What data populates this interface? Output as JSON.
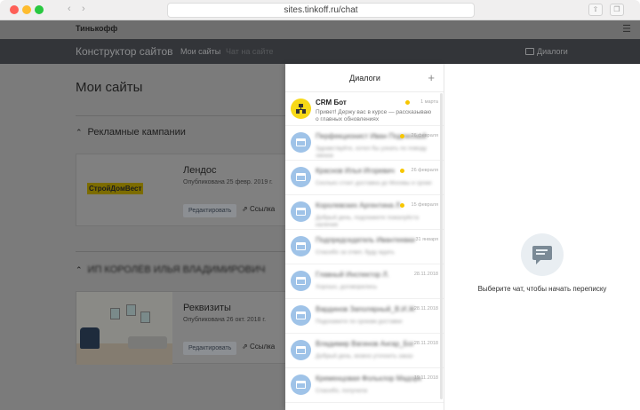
{
  "browser": {
    "url": "sites.tinkoff.ru/chat",
    "back_icon": "chevron-left-icon",
    "forward_icon": "chevron-right-icon"
  },
  "site": {
    "brand": "Тинькофф",
    "app_title": "Конструктор сайтов",
    "nav": [
      "Мои сайты",
      "Чат на сайте"
    ],
    "dialogs_link": "Диалоги"
  },
  "page": {
    "title": "Мои сайты",
    "sections": [
      {
        "title": "Рекламные кампании",
        "chevron": "^",
        "site": {
          "name": "Лендос",
          "date": "Опубликована 25 февр. 2019 г.",
          "logo_text": "СтройДомВест",
          "edit_label": "Редактировать",
          "link_label": "Ссылка"
        }
      },
      {
        "title": "ИП КОРОЛЁВ ИЛЬЯ ВЛАДИМИРОВИЧ",
        "chevron": "^",
        "site": {
          "name": "Реквизиты",
          "date": "Опубликована 26 окт. 2018 г.",
          "edit_label": "Редактировать",
          "link_label": "Ссылка"
        }
      }
    ]
  },
  "dialogs": {
    "title": "Диалоги",
    "add_label": "+",
    "items": [
      {
        "name": "CRM Бот",
        "date": "1 марта",
        "unread": true,
        "message": "Привет! Держу вас в курсе — рассказываю о главных обновлениях"
      },
      {
        "name": "Перфекционист Иван Подлесный",
        "date": "26 февраля",
        "unread": true,
        "message": "Здравствуйте, хотел бы узнать по поводу заказа"
      },
      {
        "name": "Краснов Илья Игоревич",
        "date": "26 февраля",
        "unread": true,
        "message": "Сколько стоит доставка до Москвы и сроки"
      },
      {
        "name": "Королевских Аргентина Л.",
        "date": "15 февраля",
        "unread": true,
        "message": "Добрый день, подскажите пожалуйста наличие"
      },
      {
        "name": "Подпредседатель Ивантеевки",
        "date": "31 января",
        "unread": false,
        "message": "Спасибо за ответ, буду ждать"
      },
      {
        "name": "Главный Инспектор Л.",
        "date": "28.11.2018",
        "unread": false,
        "message": "Хорошо, договорились"
      },
      {
        "name": "Вардинов Заполярный_В.И.Ж",
        "date": "28.11.2018",
        "unread": false,
        "message": "Подскажите по срокам доставки"
      },
      {
        "name": "Владимир Вагинов Ангар_Бог",
        "date": "28.11.2018",
        "unread": false,
        "message": "Добрый день, можно уточнить заказ"
      },
      {
        "name": "Кременцовая Фольклор Мадорк",
        "date": "19.11.2018",
        "unread": false,
        "message": "Спасибо, получила"
      }
    ]
  },
  "empty_state": {
    "icon": "chat-bubble-icon",
    "text": "Выберите чат, чтобы начать переписку"
  }
}
